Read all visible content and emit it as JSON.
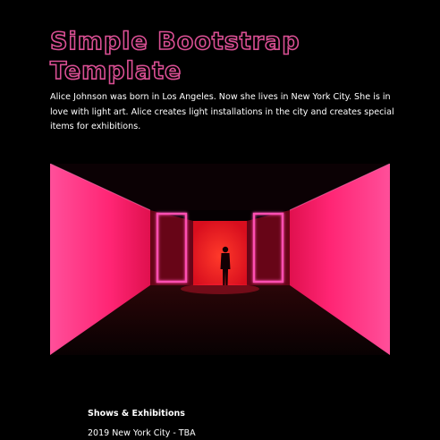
{
  "header": {
    "title": "Simple Bootstrap Template"
  },
  "intro": {
    "text": "Alice Johnson was born in Los Angeles. Now she lives in New York City. She is in love with light art. Alice creates light installations in the city and creates special items for exhibitions."
  },
  "hero_image": {
    "subject": "pink-light-tunnel-with-silhouette"
  },
  "shows": {
    "heading": "Shows & Exhibitions",
    "items": [
      "2019 New York City - TBA"
    ]
  },
  "colors": {
    "background": "#000000",
    "title_outline": "#d94f93",
    "text": "#ffffff",
    "neon_pink": "#ff1a7a",
    "neon_red": "#ff1a1a"
  }
}
